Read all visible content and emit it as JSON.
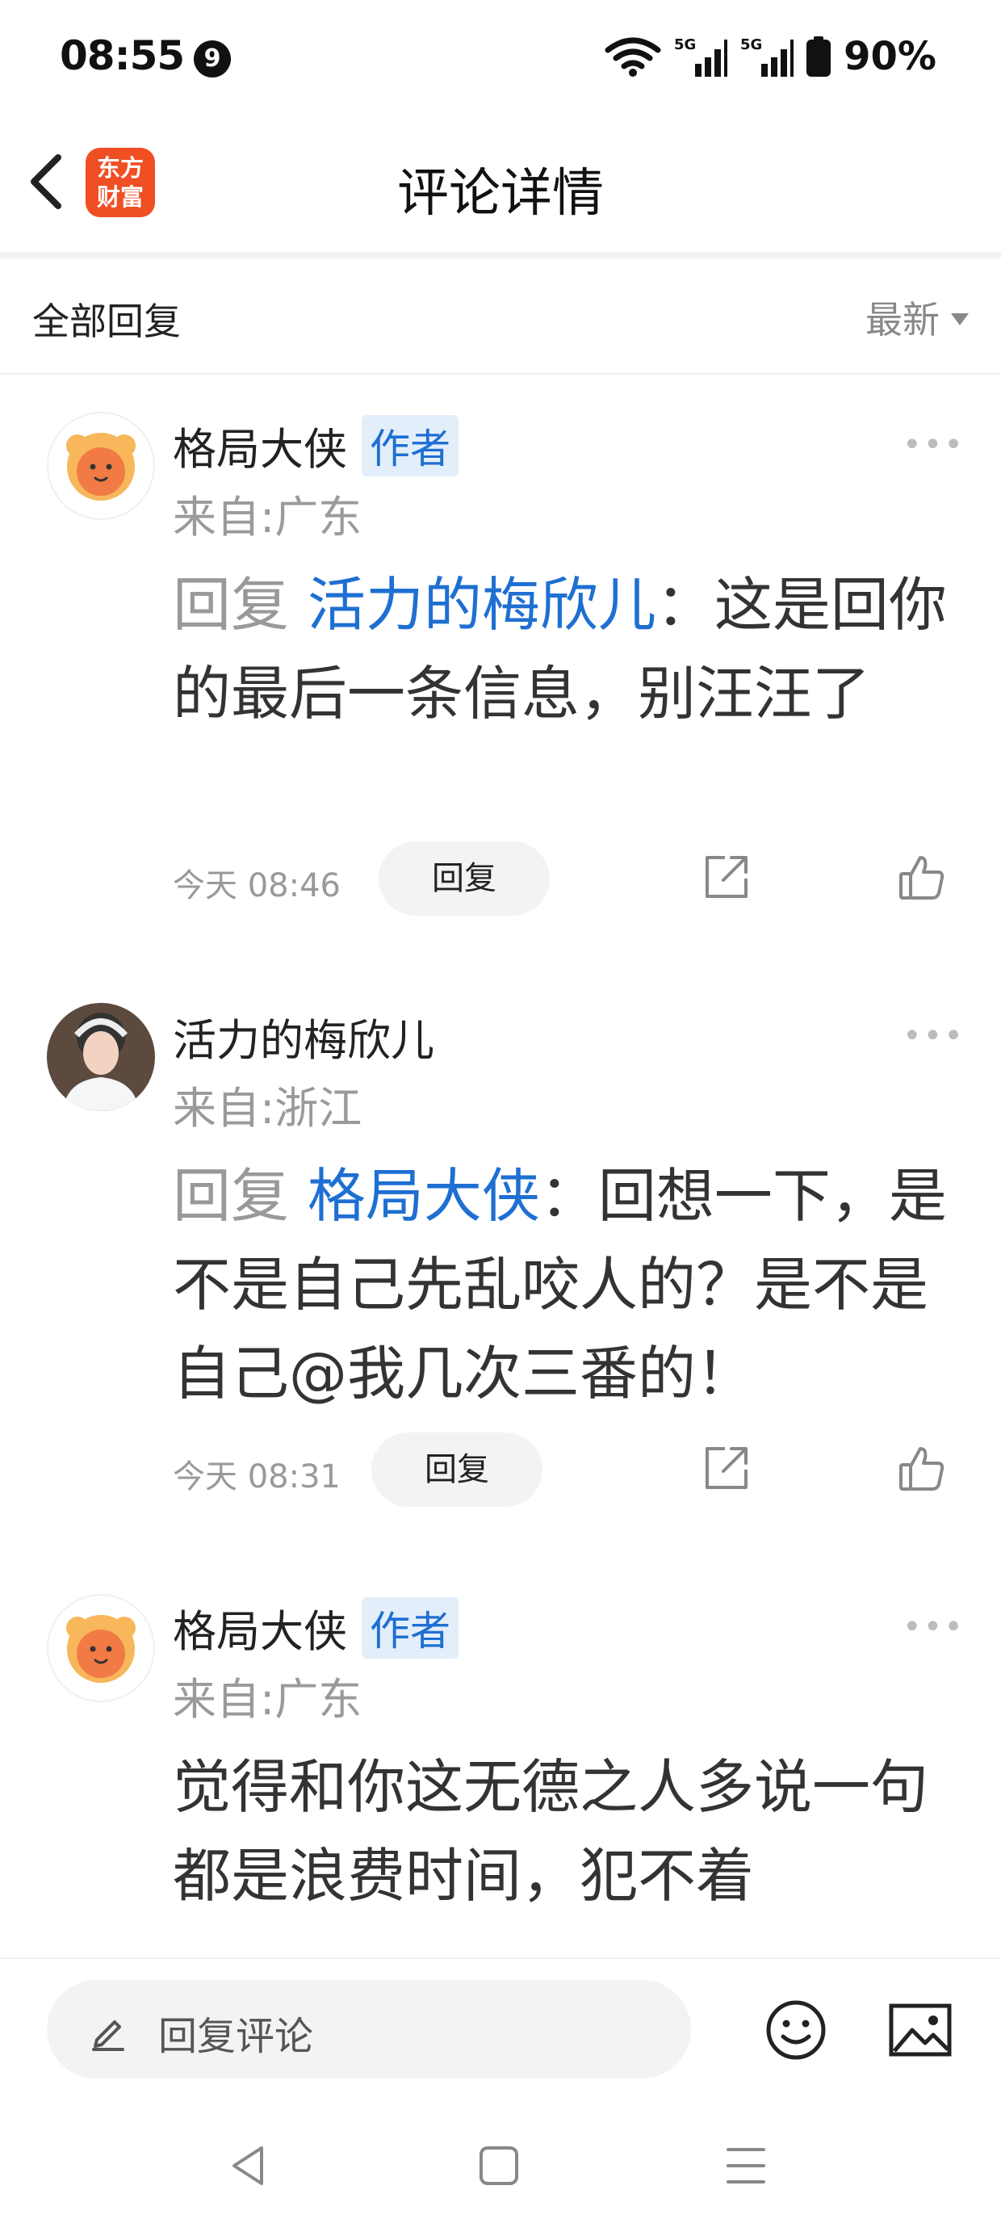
{
  "status_bar": {
    "time": "08:55",
    "notification_badge": "9",
    "signal_label_1": "5G",
    "signal_label_2": "5G",
    "battery": "90%"
  },
  "header": {
    "title": "评论详情",
    "logo_text_line1": "东方",
    "logo_text_line2": "财富"
  },
  "filter": {
    "label": "全部回复",
    "sort_label": "最新"
  },
  "comments": [
    {
      "user": "格局大侠",
      "tag": "作者",
      "location": "来自:广东",
      "reply_prefix": "回复",
      "mention": "活力的梅欣儿",
      "content": "：这是回你的最后一条信息，别汪汪了",
      "time": "今天 08:46",
      "reply_button": "回复"
    },
    {
      "user": "活力的梅欣儿",
      "location": "来自:浙江",
      "reply_prefix": "回复",
      "mention": "格局大侠",
      "content": "：回想一下，是不是自己先乱咬人的？是不是自己@我几次三番的！",
      "time": "今天 08:31",
      "reply_button": "回复"
    },
    {
      "user": "格局大侠",
      "tag": "作者",
      "location": "来自:广东",
      "content": "觉得和你这无德之人多说一句都是浪费时间，犯不着"
    }
  ],
  "bottom_bar": {
    "input_placeholder": "回复评论"
  },
  "colors": {
    "accent_blue": "#1e6fd2",
    "logo_orange": "#f04e23"
  }
}
